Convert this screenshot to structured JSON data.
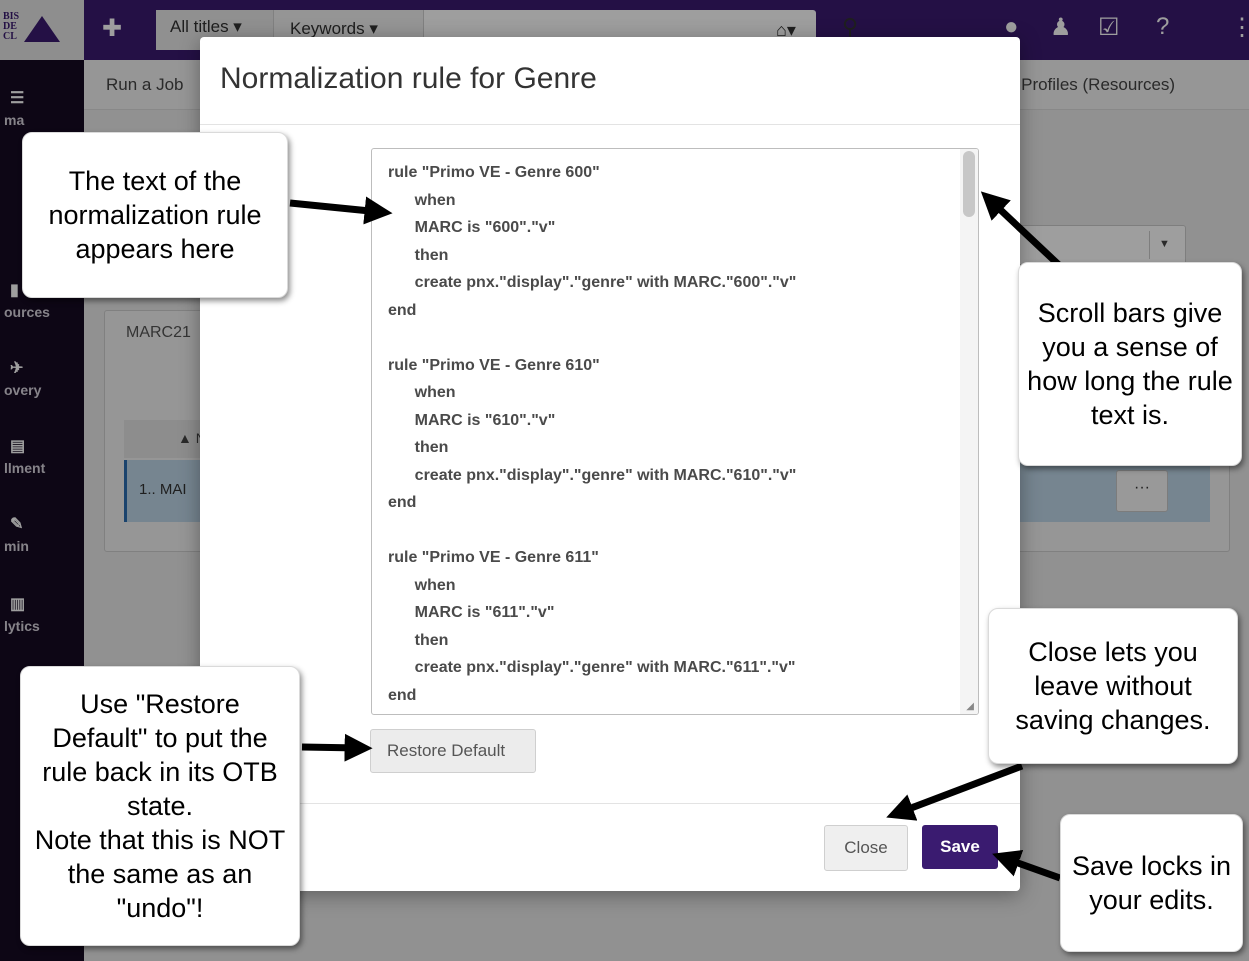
{
  "app": {
    "logo_text": "BIS DE CL",
    "scope_select": "All titles ▾",
    "keyword_select": "Keywords ▾",
    "home_icon_glyph": "⌂▾",
    "search_icon_glyph": "⚲",
    "topbar_icons": [
      "location-icon",
      "user-icon",
      "tasks-icon",
      "help-icon"
    ],
    "subbar_left": "Run a Job",
    "subbar_right": "rt Profiles (Resources)",
    "rail_items": [
      {
        "label": "ma",
        "icon": "catalog-icon"
      },
      {
        "label": "ources",
        "icon": "resources-icon"
      },
      {
        "label": "overy",
        "icon": "discovery-icon"
      },
      {
        "label": "llment",
        "icon": "fulfillment-icon"
      },
      {
        "label": "min",
        "icon": "admin-icon"
      },
      {
        "label": "lytics",
        "icon": "analytics-icon"
      }
    ],
    "panel_tab": "MARC21",
    "table_header": "▲ N",
    "table_row": "1.. MAI",
    "row_more": "···",
    "colors": {
      "brand": "#3a1b70",
      "rail": "#150a23"
    }
  },
  "modal": {
    "title": "Normalization rule for Genre",
    "rule_text": "rule \"Primo VE - Genre 600\"\n      when\n      MARC is \"600\".\"v\"\n      then\n      create pnx.\"display\".\"genre\" with MARC.\"600\".\"v\"\nend\n\nrule \"Primo VE - Genre 610\"\n      when\n      MARC is \"610\".\"v\"\n      then\n      create pnx.\"display\".\"genre\" with MARC.\"610\".\"v\"\nend\n\nrule \"Primo VE - Genre 611\"\n      when\n      MARC is \"611\".\"v\"\n      then\n      create pnx.\"display\".\"genre\" with MARC.\"611\".\"v\"\nend",
    "restore_label": "Restore Default",
    "close_label": "Close",
    "save_label": "Save"
  },
  "callouts": {
    "rule_text": "The text of the normalization rule appears here",
    "scroll_bars": "Scroll bars give you a sense of how long the rule text is.",
    "restore_default": "Use \"Restore Default\" to put the rule back in its OTB state.\nNote that this is NOT the same as an \"undo\"!",
    "close": "Close lets you leave without saving changes.",
    "save": "Save locks in your edits."
  }
}
